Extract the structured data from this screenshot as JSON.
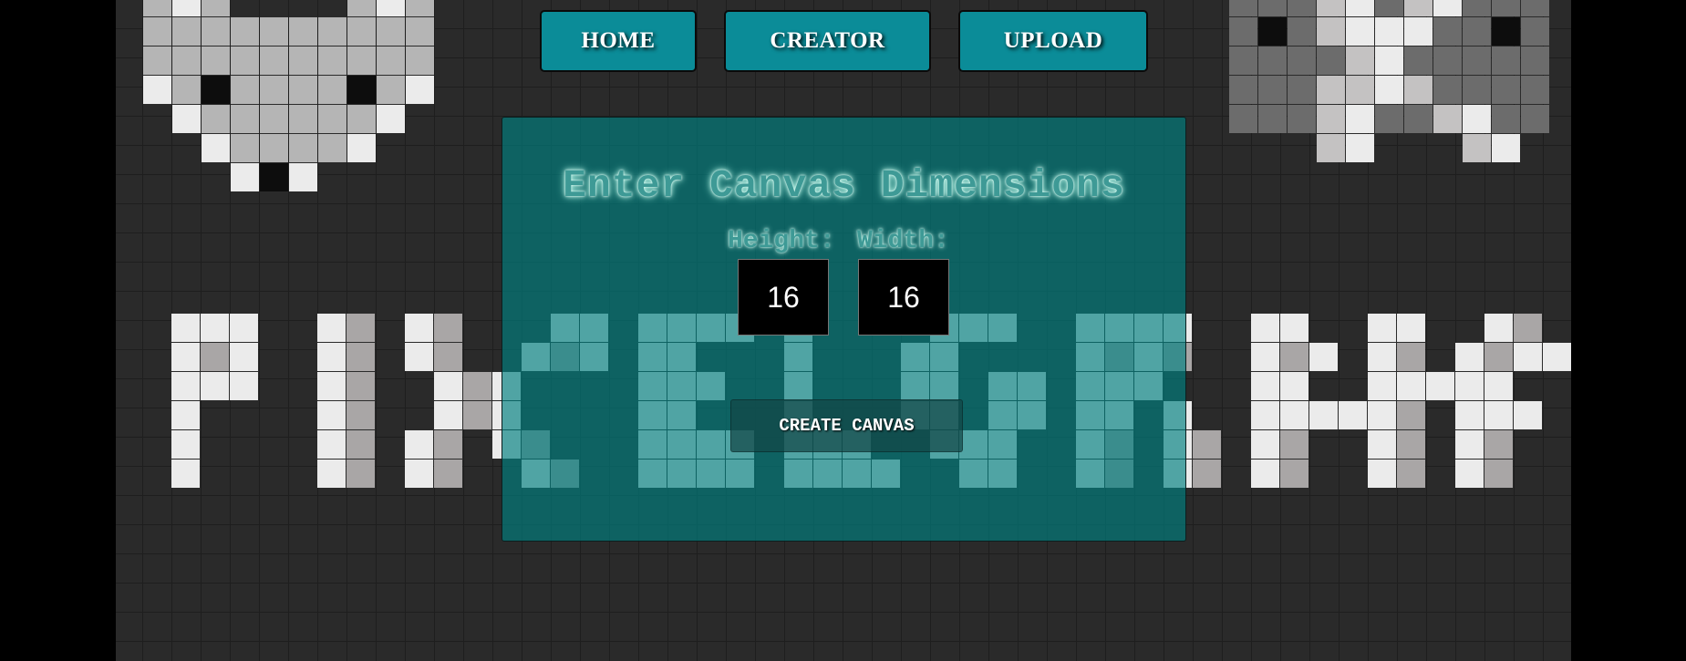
{
  "nav": {
    "home_label": "HOME",
    "creator_label": "CREATOR",
    "upload_label": "UPLOAD"
  },
  "form": {
    "title": "Enter Canvas Dimensions",
    "height_label": "Height:",
    "width_label": "Width:",
    "height_value": "16",
    "width_value": "16",
    "create_label": "CREATE CANVAS"
  },
  "colors": {
    "nav_button": "#0b8c98",
    "panel": "#008080",
    "background": "#2a2a2a"
  }
}
